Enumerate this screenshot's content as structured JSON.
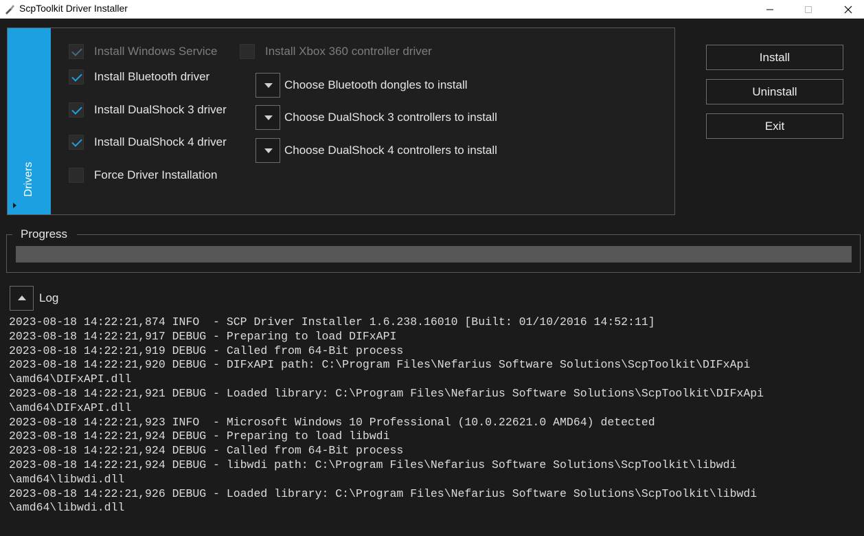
{
  "window": {
    "title": "ScpToolkit Driver Installer",
    "accent_color": "#1ba1e2"
  },
  "drivers": {
    "tab_label": "Drivers",
    "checkboxes": [
      {
        "label": "Install Windows Service",
        "checked": true,
        "enabled": false
      },
      {
        "label": "Install Xbox 360 controller driver",
        "checked": false,
        "enabled": false
      },
      {
        "label": "Install Bluetooth driver",
        "checked": true,
        "enabled": true
      },
      {
        "label": "Install DualShock 3 driver",
        "checked": true,
        "enabled": true
      },
      {
        "label": "Install DualShock 4 driver",
        "checked": true,
        "enabled": true
      },
      {
        "label": "Force Driver Installation",
        "checked": false,
        "enabled": true
      }
    ],
    "dropdowns": [
      {
        "label": "Choose Bluetooth dongles to install"
      },
      {
        "label": "Choose DualShock 3 controllers to install"
      },
      {
        "label": "Choose DualShock 4 controllers to install"
      }
    ]
  },
  "actions": {
    "install": "Install",
    "uninstall": "Uninstall",
    "exit": "Exit"
  },
  "progress": {
    "label": "Progress",
    "value": 0
  },
  "log": {
    "label": "Log",
    "lines": [
      "2023-08-18 14:22:21,874 INFO  - SCP Driver Installer 1.6.238.16010 [Built: 01/10/2016 14:52:11]",
      "2023-08-18 14:22:21,917 DEBUG - Preparing to load DIFxAPI",
      "2023-08-18 14:22:21,919 DEBUG - Called from 64-Bit process",
      "2023-08-18 14:22:21,920 DEBUG - DIFxAPI path: C:\\Program Files\\Nefarius Software Solutions\\ScpToolkit\\DIFxApi",
      "\\amd64\\DIFxAPI.dll",
      "2023-08-18 14:22:21,921 DEBUG - Loaded library: C:\\Program Files\\Nefarius Software Solutions\\ScpToolkit\\DIFxApi",
      "\\amd64\\DIFxAPI.dll",
      "2023-08-18 14:22:21,923 INFO  - Microsoft Windows 10 Professional (10.0.22621.0 AMD64) detected",
      "2023-08-18 14:22:21,924 DEBUG - Preparing to load libwdi",
      "2023-08-18 14:22:21,924 DEBUG - Called from 64-Bit process",
      "2023-08-18 14:22:21,924 DEBUG - libwdi path: C:\\Program Files\\Nefarius Software Solutions\\ScpToolkit\\libwdi",
      "\\amd64\\libwdi.dll",
      "2023-08-18 14:22:21,926 DEBUG - Loaded library: C:\\Program Files\\Nefarius Software Solutions\\ScpToolkit\\libwdi",
      "\\amd64\\libwdi.dll"
    ]
  }
}
